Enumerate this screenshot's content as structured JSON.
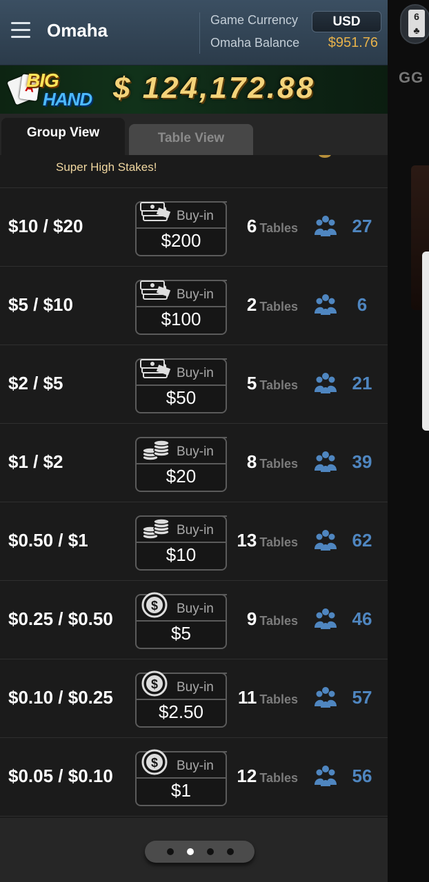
{
  "header": {
    "title": "Omaha",
    "currency_label": "Game Currency",
    "currency_value": "USD",
    "balance_label": "Omaha Balance",
    "balance_value": "$951.76"
  },
  "banner": {
    "logo_top": "BIG",
    "logo_bottom": "HAND",
    "amount": "$ 124,172.88"
  },
  "tabs": [
    {
      "label": "Group View",
      "active": true
    },
    {
      "label": "Table View",
      "active": false
    }
  ],
  "partial_row": {
    "label": "Super High Stakes!"
  },
  "list": {
    "buyin_label": "Buy-in",
    "tables_label": "Tables",
    "rows": [
      {
        "stakes": "$10 / $20",
        "buyin": "$200",
        "icon": "cash-stack-icon",
        "tables": "6",
        "players": "27"
      },
      {
        "stakes": "$5 / $10",
        "buyin": "$100",
        "icon": "cash-stack-icon",
        "tables": "2",
        "players": "6"
      },
      {
        "stakes": "$2 / $5",
        "buyin": "$50",
        "icon": "cash-stack-icon",
        "tables": "5",
        "players": "21"
      },
      {
        "stakes": "$1 / $2",
        "buyin": "$20",
        "icon": "coin-stack-icon",
        "tables": "8",
        "players": "39"
      },
      {
        "stakes": "$0.50 / $1",
        "buyin": "$10",
        "icon": "coin-stack-icon",
        "tables": "13",
        "players": "62"
      },
      {
        "stakes": "$0.25 / $0.50",
        "buyin": "$5",
        "icon": "dollar-coin-icon",
        "tables": "9",
        "players": "46"
      },
      {
        "stakes": "$0.10 / $0.25",
        "buyin": "$2.50",
        "icon": "dollar-coin-icon",
        "tables": "11",
        "players": "57"
      },
      {
        "stakes": "$0.05 / $0.10",
        "buyin": "$1",
        "icon": "dollar-coin-icon",
        "tables": "12",
        "players": "56"
      }
    ]
  },
  "pager": {
    "count": 4,
    "active_index": 1
  },
  "background_app": {
    "text": "GG"
  },
  "colors": {
    "accent_blue": "#4f86c0",
    "balance_gold": "#e8b24a",
    "stakes_label": "#f0d7a0"
  }
}
